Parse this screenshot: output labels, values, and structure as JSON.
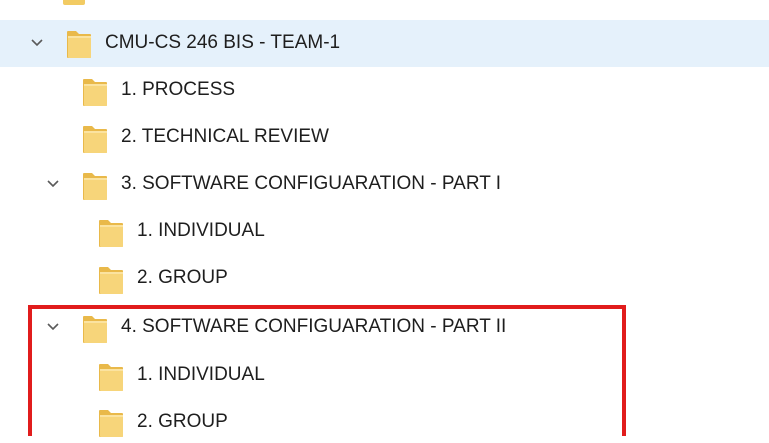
{
  "tree": {
    "root": {
      "label": "CMU-CS 246 BIS - TEAM-1",
      "expanded": true
    },
    "items": [
      {
        "label": "1. PROCESS"
      },
      {
        "label": "2. TECHNICAL REVIEW"
      },
      {
        "label": "3. SOFTWARE CONFIGUARATION - PART I",
        "expanded": true
      },
      {
        "label": "1. INDIVIDUAL"
      },
      {
        "label": "2. GROUP"
      },
      {
        "label": "4. SOFTWARE CONFIGUARATION - PART II",
        "expanded": true
      },
      {
        "label": "1. INDIVIDUAL"
      },
      {
        "label": "2. GROUP"
      }
    ]
  },
  "colors": {
    "selected_row": "#e5f1fb",
    "folder_fill": "#f7d57a",
    "folder_back": "#e9b94a",
    "highlight": "#e11c1c",
    "chevron": "#5a5a5a"
  },
  "icons": {
    "expand": "chevron-down-icon",
    "folder": "folder-icon"
  }
}
